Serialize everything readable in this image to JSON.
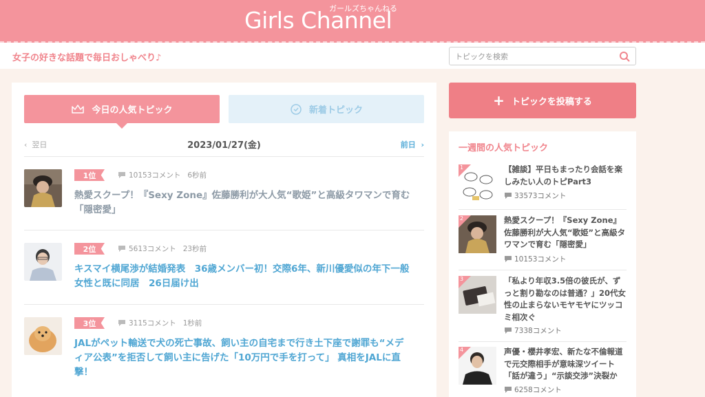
{
  "header": {
    "logo": "Girls Channel",
    "logo_sub": "ガールズちゃんねる",
    "tagline": "女子の好きな話題で毎日おしゃべり♪",
    "search_placeholder": "トピックを検索"
  },
  "tabs": {
    "today": "今日の人気トピック",
    "new": "新着トピック"
  },
  "datebar": {
    "prev": "翌日",
    "date": "2023/01/27(金)",
    "next": "前日"
  },
  "topics": [
    {
      "rank": "1位",
      "comments": "10153コメント",
      "time": "6秒前",
      "title": "熱愛スクープ！『Sexy Zone』佐藤勝利が大人気“歌姫”と高級タワマンで育む「隠密愛」"
    },
    {
      "rank": "2位",
      "comments": "5613コメント",
      "time": "23秒前",
      "title": "キスマイ横尾渉が結婚発表　36歳メンバー初！交際6年、新川優愛似の年下一般女性と既に同居　26日届け出"
    },
    {
      "rank": "3位",
      "comments": "3115コメント",
      "time": "1秒前",
      "title": "JALがペット輸送で犬の死亡事故、飼い主の自宅まで行き土下座で謝罪も“メディア公表”を拒否して飼い主に告げた「10万円で手を打って」 真相をJALに直撃！"
    }
  ],
  "sidebar": {
    "post_button": "トピックを投稿する",
    "weekly_title": "一週間の人気トピック",
    "items": [
      {
        "rank": "1",
        "title": "【雑談】平日もまったり会話を楽しみたい人のトピPart3",
        "comments": "33573コメント"
      },
      {
        "rank": "2",
        "title": "熱愛スクープ！『Sexy Zone』佐藤勝利が大人気“歌姫”と高級タワマンで育む「隠密愛」",
        "comments": "10153コメント"
      },
      {
        "rank": "3",
        "title": "「私より年収3.5倍の彼氏が、ずっと割り勘なのは普通？」20代女性の止まらないモヤモヤにツッコミ相次ぐ",
        "comments": "7338コメント"
      },
      {
        "rank": "4",
        "title": "声優・櫻井孝宏、新たな不倫報道で元交際相手が意味深ツイート「話が違う」“示談交渉”決裂か",
        "comments": "6258コメント"
      }
    ]
  },
  "colors": {
    "brand_pink": "#f4949c",
    "link_blue": "#4fa6d3",
    "tab_blue_bg": "#e4f1f9"
  }
}
